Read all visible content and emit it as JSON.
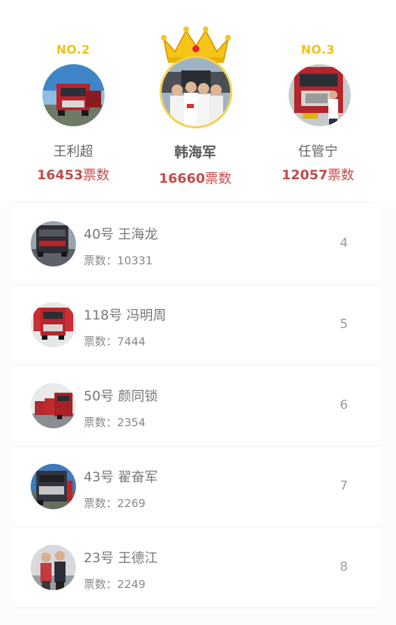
{
  "podium": {
    "second": {
      "rank_label": "NO.2",
      "name": "王利超",
      "votes": "16453",
      "votes_unit": "票数",
      "avatar": "truck-photo"
    },
    "first": {
      "name": "韩海军",
      "votes": "16660",
      "votes_unit": "票数",
      "avatar": "group-photo",
      "crown": "crown-icon"
    },
    "third": {
      "rank_label": "NO.3",
      "name": "任管宁",
      "votes": "12057",
      "votes_unit": "票数",
      "avatar": "truck-with-person-photo"
    }
  },
  "entries": [
    {
      "number": "40号",
      "name": "王海龙",
      "votes_label": "票数：",
      "votes": "10331",
      "rank": "4"
    },
    {
      "number": "118号",
      "name": "冯明周",
      "votes_label": "票数：",
      "votes": "7444",
      "rank": "5"
    },
    {
      "number": "50号",
      "name": "颜同锁",
      "votes_label": "票数：",
      "votes": "2354",
      "rank": "6"
    },
    {
      "number": "43号",
      "name": "翟奋军",
      "votes_label": "票数：",
      "votes": "2269",
      "rank": "7"
    },
    {
      "number": "23号",
      "name": "王德江",
      "votes_label": "票数：",
      "votes": "2249",
      "rank": "8"
    }
  ],
  "colors": {
    "gold": "#f2c21a",
    "votes_red": "#c64a4a",
    "text_gray": "#777777",
    "truck_red": "#b8242a"
  }
}
